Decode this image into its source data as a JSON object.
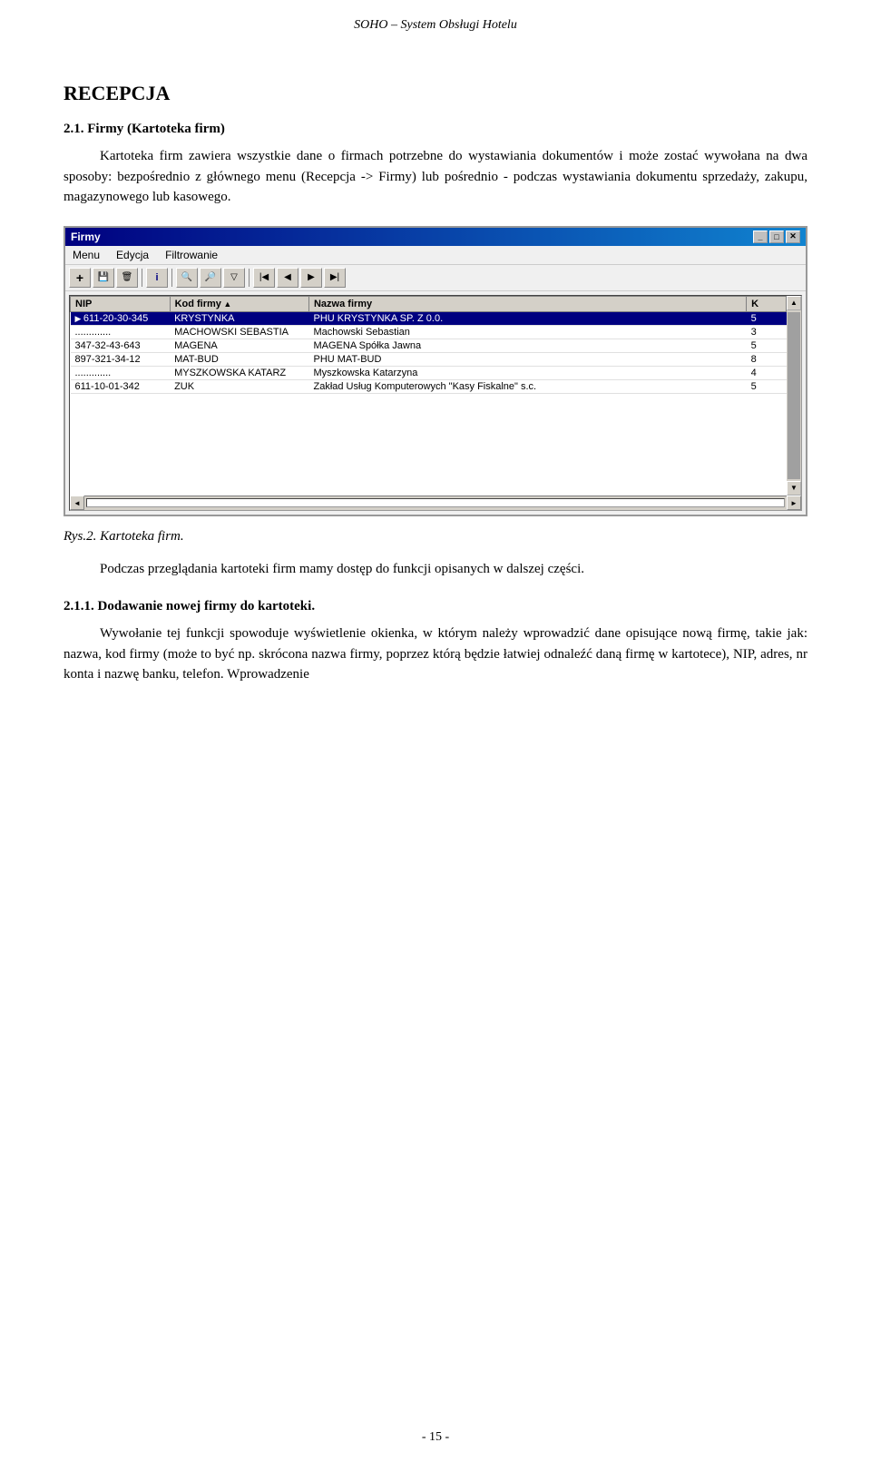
{
  "header": {
    "title": "SOHO – System Obsługi Hotelu"
  },
  "page": {
    "section_heading": "RECEPCJA",
    "subsection_title": "2.1. Firmy (Kartoteka firm)",
    "intro_paragraph": "Kartoteka firm zawiera wszystkie dane o firmach potrzebne do wystawiania dokumentów i może zostać wywołana na dwa sposoby: bezpośrednio z głównego menu (Recepcja -> Firmy) lub pośrednio - podczas wystawiania dokumentu sprzedaży, zakupu, magazynowego lub kasowego.",
    "caption": "Rys.2. Kartoteka firm.",
    "para2": "Podczas przeglądania kartoteki firm mamy dostęp do funkcji opisanych w dalszej części.",
    "subsection2_title": "2.1.1. Dodawanie nowej firmy do kartoteki.",
    "para3": "Wywołanie tej funkcji spowoduje wyświetlenie okienka, w którym należy wprowadzić dane opisujące nową firmę, takie jak: nazwa, kod firmy (może to być np. skrócona nazwa firmy, poprzez którą będzie łatwiej odnaleźć daną firmę w kartotece), NIP, adres, nr konta i nazwę banku, telefon. Wprowadzenie"
  },
  "dialog": {
    "title": "Firmy",
    "menu_items": [
      "Menu",
      "Edycja",
      "Filtrowanie"
    ],
    "toolbar_buttons": [
      {
        "icon": "✚",
        "name": "add"
      },
      {
        "icon": "🖫",
        "name": "save"
      },
      {
        "icon": "✖",
        "name": "delete"
      },
      {
        "icon": "ℹ",
        "name": "info"
      },
      {
        "icon": "🔍",
        "name": "search"
      },
      {
        "icon": "🔎",
        "name": "search2"
      },
      {
        "icon": "▽",
        "name": "filter"
      },
      {
        "icon": "⏮",
        "name": "first"
      },
      {
        "icon": "◀",
        "name": "prev"
      },
      {
        "icon": "▶",
        "name": "next"
      },
      {
        "icon": "⏭",
        "name": "last"
      }
    ],
    "table": {
      "columns": [
        "NIP",
        "Kod firmy",
        "Nazwa firmy",
        "K"
      ],
      "rows": [
        {
          "nip": "611-20-30-345",
          "kod": "KRYSTYNKA",
          "nazwa": "PHU KRYSTYNKA SP. Z 0.0.",
          "k": "5",
          "selected": true
        },
        {
          "nip": ".............",
          "kod": "MACHOWSKI SEBASTIA",
          "nazwa": "Machowski Sebastian",
          "k": "3",
          "selected": false
        },
        {
          "nip": "347-32-43-643",
          "kod": "MAGENA",
          "nazwa": "MAGENA Spółka Jawna",
          "k": "5",
          "selected": false
        },
        {
          "nip": "897-321-34-12",
          "kod": "MAT-BUD",
          "nazwa": "PHU MAT-BUD",
          "k": "8",
          "selected": false
        },
        {
          "nip": ".............",
          "kod": "MYSZKOWSKA KATARZ",
          "nazwa": "Myszkowska Katarzyna",
          "k": "4",
          "selected": false
        },
        {
          "nip": "611-10-01-342",
          "kod": "ZUK",
          "nazwa": "Zakład Usług Komputerowych \"Kasy Fiskalne\" s.c.",
          "k": "5",
          "selected": false
        }
      ]
    },
    "titlebar_buttons": [
      "_",
      "□",
      "✕"
    ]
  },
  "footer": {
    "page_number": "- 15 -"
  }
}
